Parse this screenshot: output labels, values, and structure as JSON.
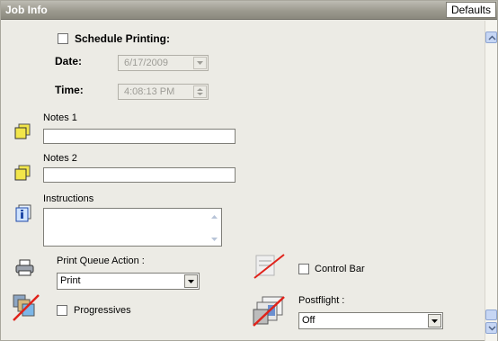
{
  "header": {
    "title": "Job Info",
    "defaults_label": "Defaults"
  },
  "schedule": {
    "label": "Schedule Printing:",
    "checked": false,
    "date_label": "Date:",
    "date_value": "6/17/2009",
    "time_label": "Time:",
    "time_value": "4:08:13 PM"
  },
  "notes1": {
    "label": "Notes 1",
    "value": ""
  },
  "notes2": {
    "label": "Notes 2",
    "value": ""
  },
  "instructions": {
    "label": "Instructions",
    "value": ""
  },
  "print_queue": {
    "label": "Print Queue Action :",
    "selected": "Print"
  },
  "control_bar": {
    "label": "Control Bar",
    "checked": false
  },
  "progressives": {
    "label": "Progressives",
    "checked": false
  },
  "postflight": {
    "label": "Postflight :",
    "selected": "Off"
  },
  "icons": {
    "notes1": "sticky-note-icon",
    "notes2": "sticky-note-icon",
    "instructions": "info-icon",
    "print_queue": "printer-icon",
    "control_bar": "control-bar-disabled-icon",
    "progressives": "progressives-disabled-icon",
    "postflight": "postflight-disabled-icon"
  },
  "colors": {
    "header_bg": "#9c9a8f",
    "panel_bg": "#ecebe5",
    "note_yellow": "#f2e64a",
    "scrollbar_blue": "#c6d6f4"
  }
}
